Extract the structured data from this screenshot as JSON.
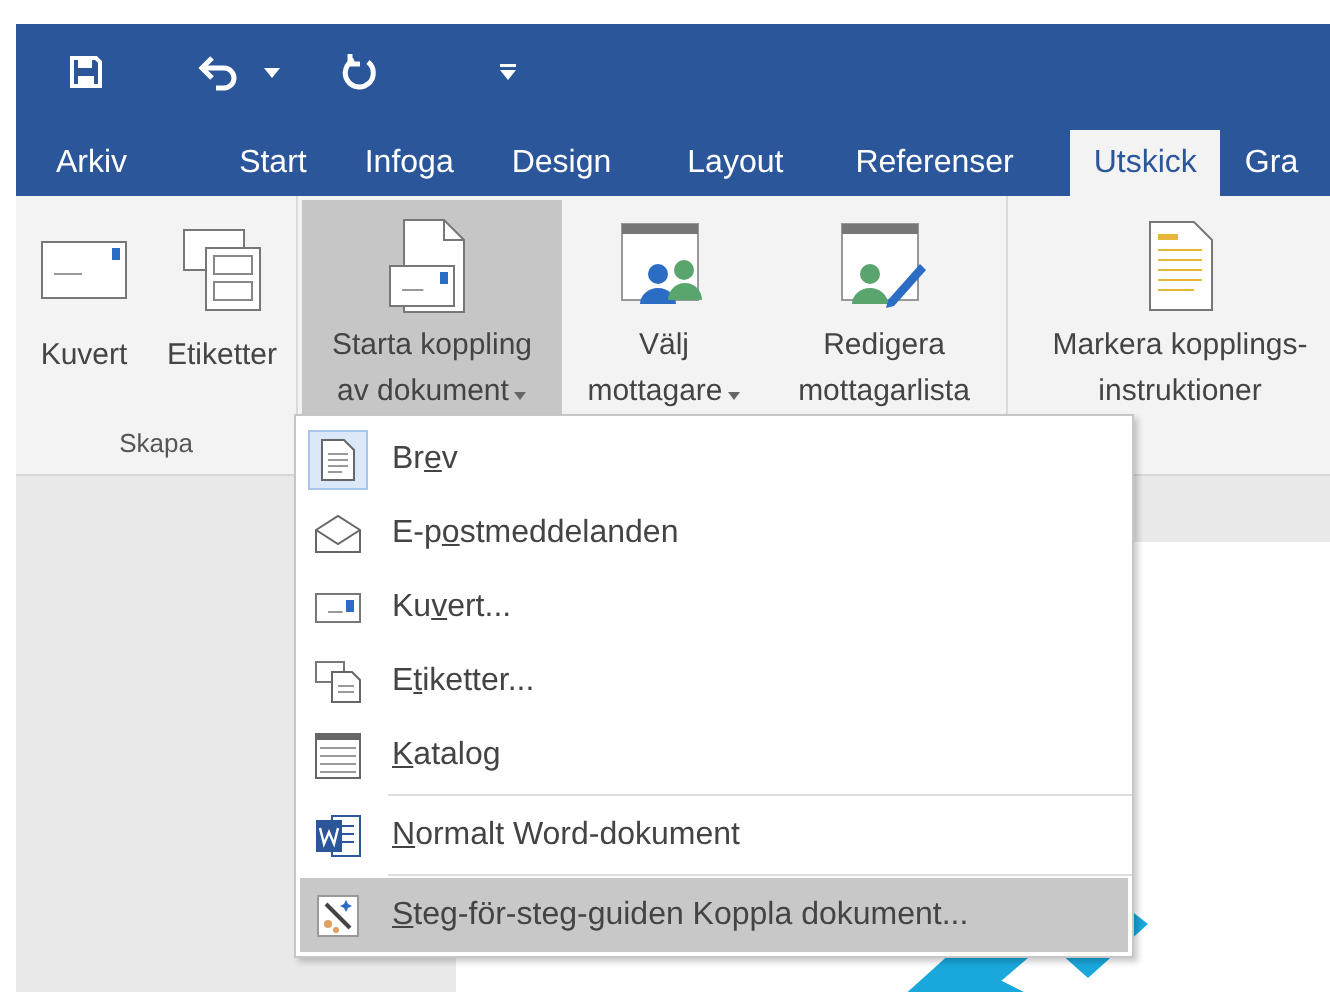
{
  "tabs": [
    {
      "label": "Arkiv",
      "selected": false
    },
    {
      "label": "Start",
      "selected": false
    },
    {
      "label": "Infoga",
      "selected": false
    },
    {
      "label": "Design",
      "selected": false
    },
    {
      "label": "Layout",
      "selected": false
    },
    {
      "label": "Referenser",
      "selected": false
    },
    {
      "label": "Utskick",
      "selected": true
    },
    {
      "label": "Gra",
      "selected": false
    }
  ],
  "ribbon": {
    "groups": [
      {
        "label": "Skapa",
        "buttons": [
          {
            "lines": [
              "Kuvert"
            ],
            "has_dropdown": false,
            "pressed": false
          },
          {
            "lines": [
              "Etiketter"
            ],
            "has_dropdown": false,
            "pressed": false
          }
        ]
      },
      {
        "buttons": [
          {
            "lines": [
              "Starta koppling",
              "av dokument"
            ],
            "has_dropdown": true,
            "pressed": true
          },
          {
            "lines": [
              "Välj",
              "mottagare"
            ],
            "has_dropdown": true,
            "pressed": false
          },
          {
            "lines": [
              "Redigera",
              "mottagarlista"
            ],
            "has_dropdown": false,
            "pressed": false
          }
        ]
      },
      {
        "buttons": [
          {
            "lines": [
              "Markera kopplings-",
              "instruktioner"
            ],
            "has_dropdown": false,
            "pressed": false
          }
        ]
      }
    ]
  },
  "menu": {
    "sections": [
      [
        {
          "before": "Br",
          "access_key": "e",
          "after": "v",
          "checked": true,
          "highlighted": false
        },
        {
          "before": "E-p",
          "access_key": "o",
          "after": "stmeddelanden",
          "checked": false,
          "highlighted": false
        },
        {
          "before": "Ku",
          "access_key": "v",
          "after": "ert...",
          "checked": false,
          "highlighted": false
        },
        {
          "before": "E",
          "access_key": "t",
          "after": "iketter...",
          "checked": false,
          "highlighted": false
        },
        {
          "access_key": "K",
          "after": "atalog",
          "checked": false,
          "highlighted": false
        }
      ],
      [
        {
          "access_key": "N",
          "after": "ormalt Word-dokument",
          "checked": false,
          "highlighted": false
        }
      ],
      [
        {
          "access_key": "S",
          "after": "teg-för-steg-guiden Koppla dokument...",
          "checked": false,
          "highlighted": true
        }
      ]
    ]
  }
}
